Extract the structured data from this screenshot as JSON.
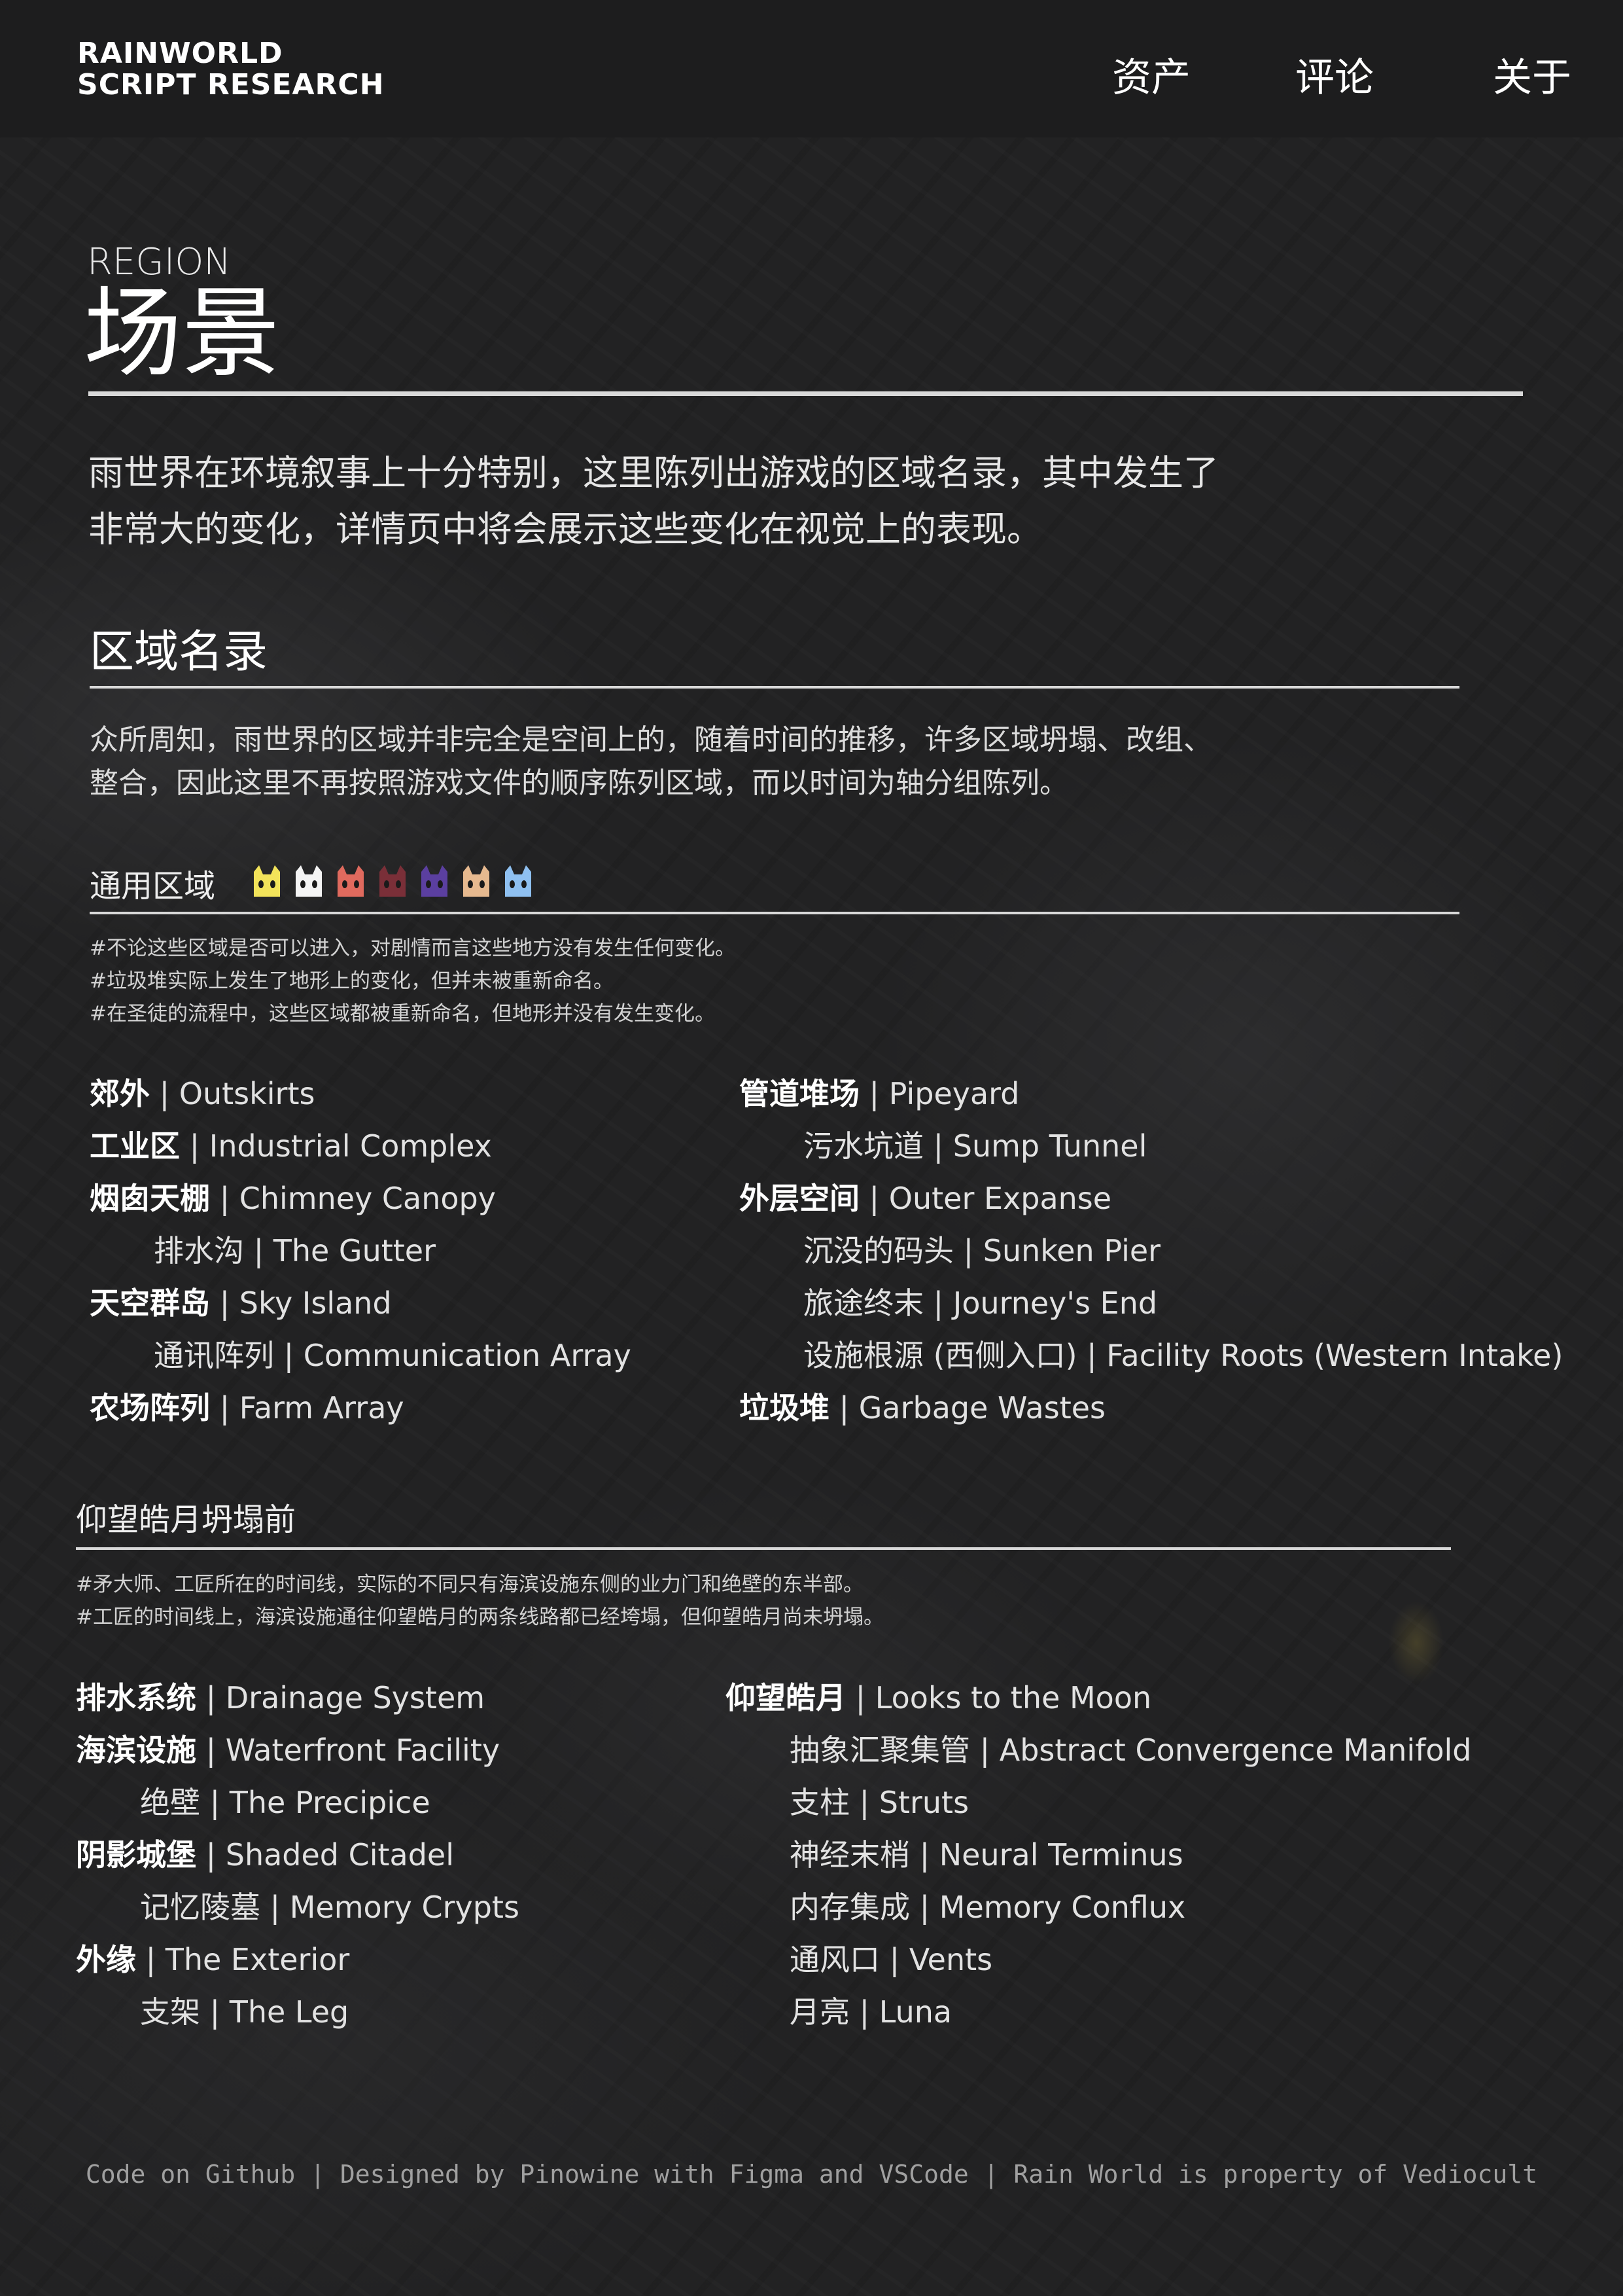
{
  "header": {
    "logo_line1": "RAINWORLD",
    "logo_line2": "SCRIPT RESEARCH",
    "nav": [
      "资产",
      "评论",
      "关于"
    ]
  },
  "page": {
    "kicker": "REGION",
    "title": "场景",
    "intro_line1": "雨世界在环境叙事上十分特别，这里陈列出游戏的区域名录，其中发生了",
    "intro_line2": "非常大的变化，详情页中将会展示这些变化在视觉上的表现。"
  },
  "directory": {
    "heading": "区域名录",
    "desc_line1": "众所周知，雨世界的区域并非完全是空间上的，随着时间的推移，许多区域坍塌、改组、",
    "desc_line2": "整合，因此这里不再按照游戏文件的顺序陈列区域，而以时间为轴分组陈列。"
  },
  "general": {
    "heading": "通用区域",
    "slugcat_icons": [
      {
        "name": "yellow-slugcat-icon",
        "color": "#f2e35a"
      },
      {
        "name": "white-slugcat-icon",
        "color": "#f4f4f4"
      },
      {
        "name": "red-slugcat-icon",
        "color": "#e06a5e"
      },
      {
        "name": "darkred-slugcat-icon",
        "color": "#7a2f38"
      },
      {
        "name": "purple-slugcat-icon",
        "color": "#5b3fa0"
      },
      {
        "name": "tan-slugcat-icon",
        "color": "#e6b98f"
      },
      {
        "name": "blue-slugcat-icon",
        "color": "#8fc0f0"
      }
    ],
    "notes": [
      "#不论这些区域是否可以进入，对剧情而言这些地方没有发生任何变化。",
      "#垃圾堆实际上发生了地形上的变化，但并未被重新命名。",
      "#在圣徒的流程中，这些区域都被重新命名，但地形并没有发生变化。"
    ],
    "left": [
      {
        "zh": "郊外",
        "en": "Outskirts",
        "sub": false
      },
      {
        "zh": "工业区",
        "en": "Industrial Complex",
        "sub": false
      },
      {
        "zh": "烟囱天棚",
        "en": "Chimney Canopy",
        "sub": false
      },
      {
        "zh": "排水沟",
        "en": "The Gutter",
        "sub": true
      },
      {
        "zh": "天空群岛",
        "en": "Sky Island",
        "sub": false
      },
      {
        "zh": "通讯阵列",
        "en": "Communication Array",
        "sub": true
      },
      {
        "zh": "农场阵列",
        "en": "Farm Array",
        "sub": false
      }
    ],
    "right": [
      {
        "zh": "管道堆场",
        "en": "Pipeyard",
        "sub": false
      },
      {
        "zh": "污水坑道",
        "en": "Sump Tunnel",
        "sub": true
      },
      {
        "zh": "外层空间",
        "en": "Outer Expanse",
        "sub": false
      },
      {
        "zh": "沉没的码头",
        "en": "Sunken Pier",
        "sub": true
      },
      {
        "zh": "旅途终末",
        "en": "Journey's End",
        "sub": true
      },
      {
        "zh": "设施根源 (西侧入口)",
        "en": "Facility Roots (Western Intake)",
        "sub": true
      },
      {
        "zh": "垃圾堆",
        "en": "Garbage Wastes",
        "sub": false
      }
    ]
  },
  "before_moon": {
    "heading": "仰望皓月坍塌前",
    "notes": [
      "#矛大师、工匠所在的时间线，实际的不同只有海滨设施东侧的业力门和绝壁的东半部。",
      "#工匠的时间线上，海滨设施通往仰望皓月的两条线路都已经垮塌，但仰望皓月尚未坍塌。"
    ],
    "left": [
      {
        "zh": "排水系统",
        "en": "Drainage System",
        "sub": false
      },
      {
        "zh": "海滨设施",
        "en": "Waterfront Facility",
        "sub": false
      },
      {
        "zh": "绝壁",
        "en": "The Precipice",
        "sub": true
      },
      {
        "zh": "阴影城堡",
        "en": "Shaded Citadel",
        "sub": false
      },
      {
        "zh": "记忆陵墓",
        "en": "Memory Crypts",
        "sub": true
      },
      {
        "zh": "外缘",
        "en": "The Exterior",
        "sub": false
      },
      {
        "zh": "支架",
        "en": "The Leg",
        "sub": true
      }
    ],
    "right": [
      {
        "zh": "仰望皓月",
        "en": "Looks to the Moon",
        "sub": false
      },
      {
        "zh": "抽象汇聚集管",
        "en": "Abstract Convergence Manifold",
        "sub": true
      },
      {
        "zh": "支柱",
        "en": "Struts",
        "sub": true
      },
      {
        "zh": "神经末梢",
        "en": "Neural Terminus",
        "sub": true
      },
      {
        "zh": "内存集成",
        "en": "Memory Conflux",
        "sub": true
      },
      {
        "zh": "通风口",
        "en": "Vents",
        "sub": true
      },
      {
        "zh": "月亮",
        "en": "Luna",
        "sub": true
      }
    ]
  },
  "footer": {
    "text": "Code on Github | Designed by Pinowine with Figma and VSCode | Rain World is property of Vediocult"
  }
}
